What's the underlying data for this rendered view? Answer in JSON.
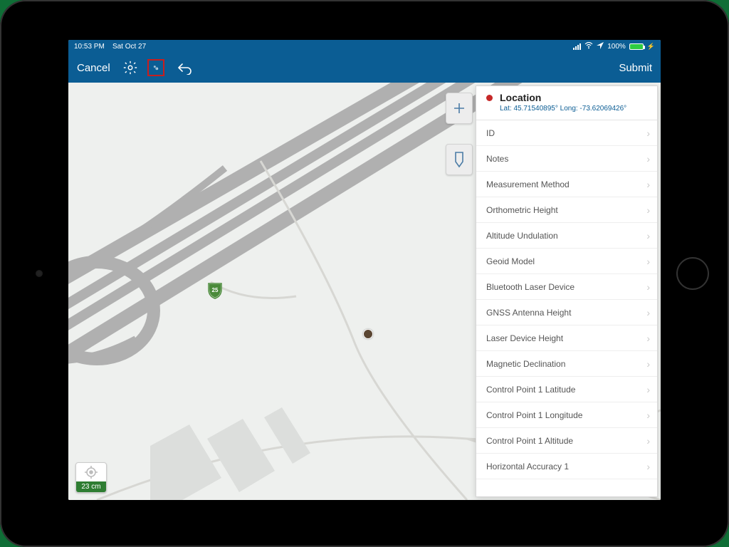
{
  "status": {
    "time": "10:53 PM",
    "date": "Sat Oct 27",
    "battery": "100%"
  },
  "nav": {
    "cancel": "Cancel",
    "submit": "Submit"
  },
  "route_shield": "25",
  "accuracy": {
    "value": "23 cm"
  },
  "panel": {
    "title": "Location",
    "coords": "Lat: 45.71540895° Long: -73.62069426°",
    "fields": [
      "ID",
      "Notes",
      "Measurement Method",
      "Orthometric Height",
      "Altitude Undulation",
      "Geoid Model",
      "Bluetooth Laser Device",
      "GNSS Antenna Height",
      "Laser Device Height",
      "Magnetic Declination",
      "Control Point 1 Latitude",
      "Control Point 1 Longitude",
      "Control Point 1 Altitude",
      "Horizontal Accuracy 1"
    ]
  }
}
